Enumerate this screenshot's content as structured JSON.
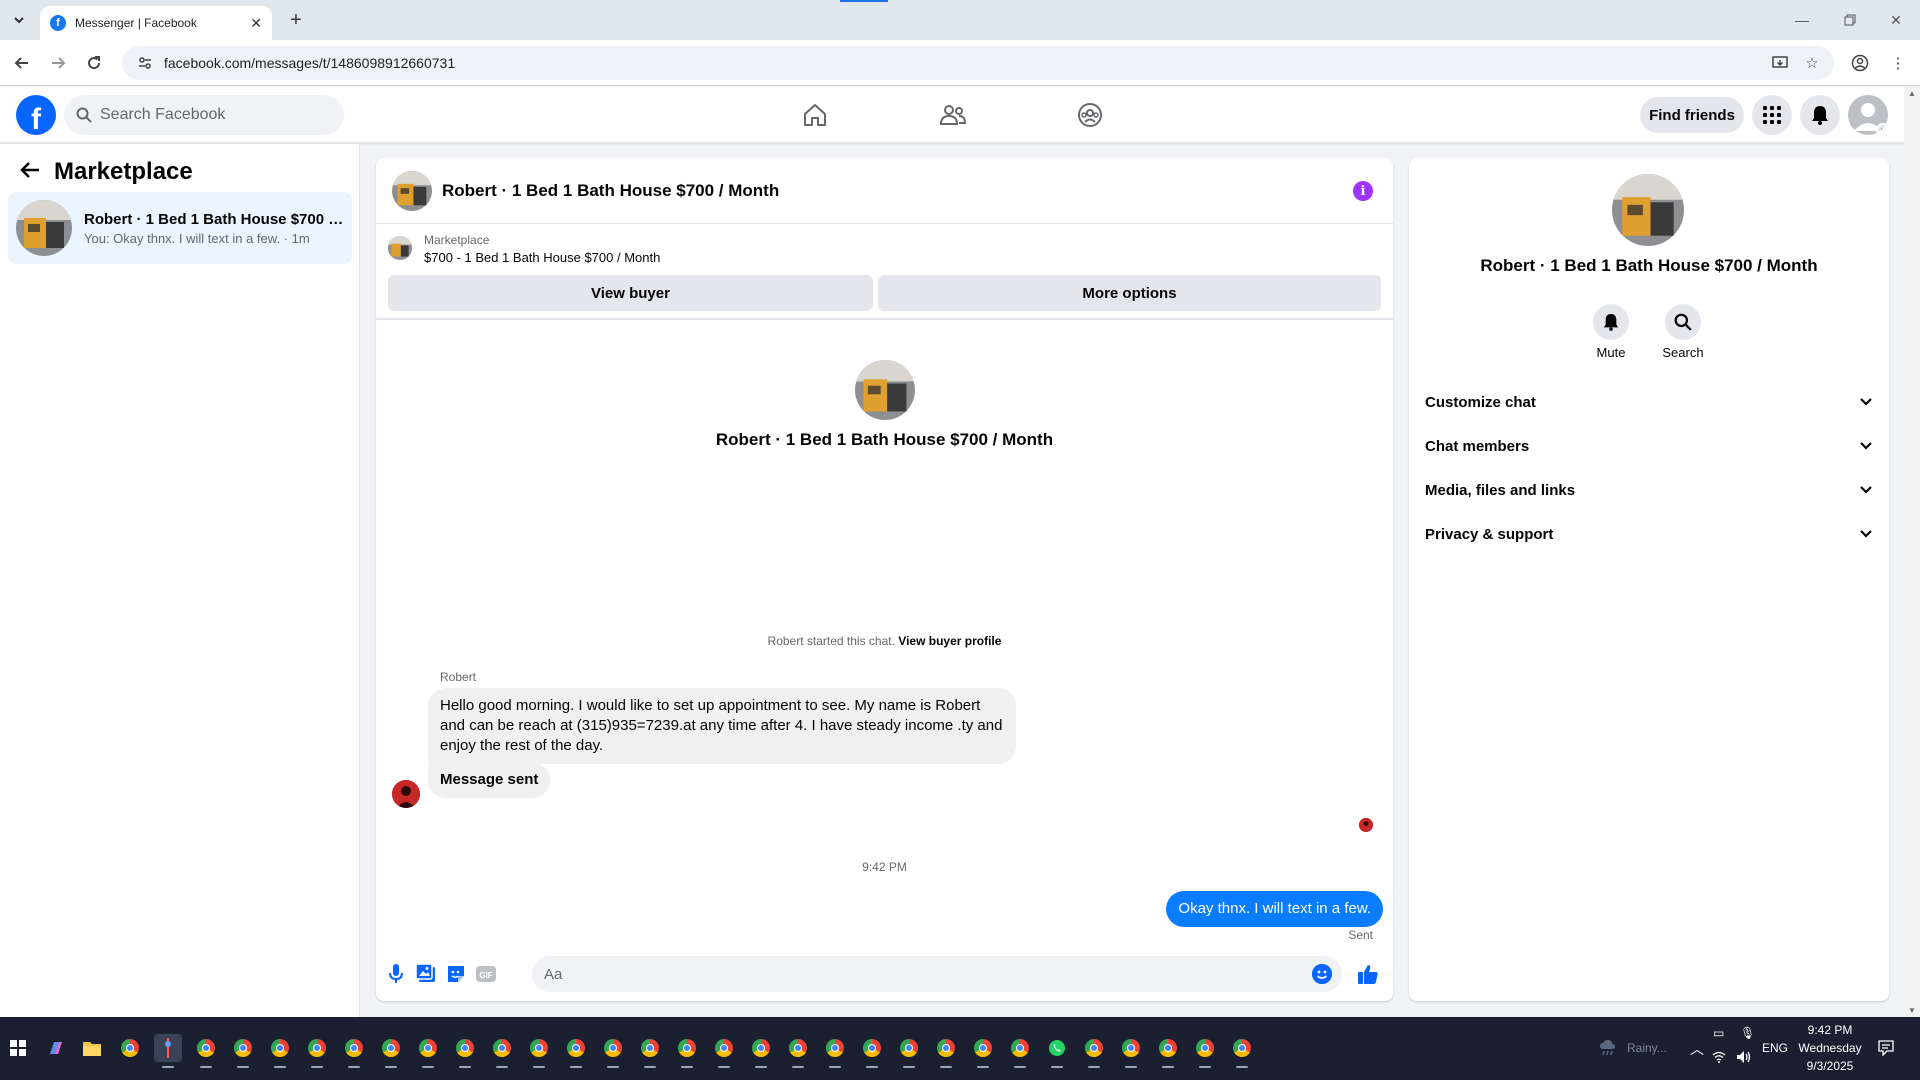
{
  "browser": {
    "tab_title": "Messenger | Facebook",
    "favicon_letter": "f",
    "new_tab_label": "+",
    "url": "facebook.com/messages/t/1486098912660731"
  },
  "header": {
    "logo_letter": "f",
    "search_placeholder": "Search Facebook",
    "find_friends": "Find friends"
  },
  "sidebar": {
    "title": "Marketplace",
    "conversation": {
      "name": "Robert · 1 Bed 1 Bath House $700 /...",
      "snippet": "You: Okay thnx. I will text in a few. · 1m"
    }
  },
  "chat": {
    "title": "Robert · 1 Bed 1 Bath House $700 / Month",
    "marketplace_label": "Marketplace",
    "listing": "$700 - 1 Bed 1 Bath House $700 / Month",
    "view_buyer": "View buyer",
    "more_options": "More options",
    "intro_name": "Robert · 1 Bed 1 Bath House $700 / Month",
    "started_text": "Robert started this chat.",
    "view_buyer_profile": "View buyer profile",
    "sender_name": "Robert",
    "messages": [
      {
        "from": "Robert",
        "text": "Hello good morning. I would like to set up appointment to see. My name is Robert and can be reach at (315)935=7239.at any time after 4. I have steady income .ty and enjoy the rest of the day."
      },
      {
        "from": "Robert",
        "text": "Message sent"
      },
      {
        "from": "me",
        "text": "Okay thnx. I will text in a few."
      }
    ],
    "timestamp": "9:42 PM",
    "sent_status": "Sent",
    "composer_placeholder": "Aa",
    "gif_label": "GIF"
  },
  "info_panel": {
    "name": "Robert · 1 Bed 1 Bath House $700 / Month",
    "actions": [
      {
        "label": "Mute",
        "icon": "bell-icon"
      },
      {
        "label": "Search",
        "icon": "search-icon"
      }
    ],
    "sections": [
      "Customize chat",
      "Chat members",
      "Media, files and links",
      "Privacy & support"
    ]
  },
  "taskbar": {
    "weather": "Rainy...",
    "language": "ENG",
    "time": "9:42 PM",
    "day": "Wednesday",
    "date": "9/3/2025"
  },
  "colors": {
    "facebook_blue": "#0866ff",
    "outgoing_bubble": "#0a7cff",
    "info_purple": "#a033ff",
    "taskbar": "#1b2030"
  }
}
